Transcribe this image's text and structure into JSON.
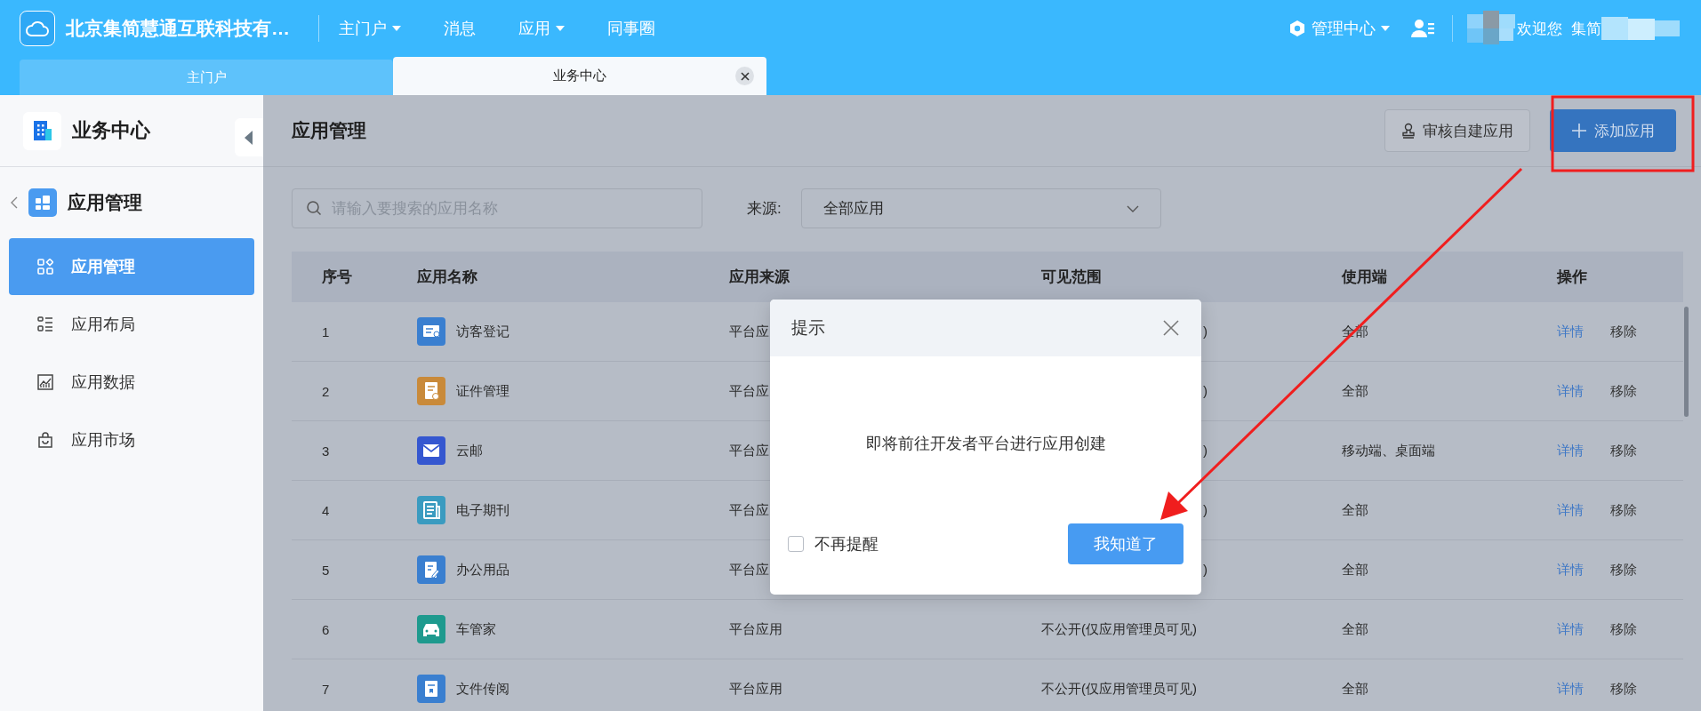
{
  "top_bar": {
    "company_name": "北京集简慧通互联科技有…",
    "nav": [
      {
        "label": "主门户",
        "dropdown": true
      },
      {
        "label": "消息",
        "dropdown": false
      },
      {
        "label": "应用",
        "dropdown": true
      },
      {
        "label": "同事圈",
        "dropdown": false
      }
    ],
    "admin_menu": {
      "label": "管理中心",
      "dropdown": true
    },
    "welcome": "欢迎您",
    "user_name": "集简"
  },
  "page_tabs": [
    {
      "label": "主门户",
      "selected": false,
      "closable": false
    },
    {
      "label": "业务中心",
      "selected": true,
      "closable": true
    }
  ],
  "sidebar": {
    "title": "业务中心",
    "group": "应用管理",
    "items": [
      {
        "label": "应用管理",
        "selected": true
      },
      {
        "label": "应用布局",
        "selected": false
      },
      {
        "label": "应用数据",
        "selected": false
      },
      {
        "label": "应用市场",
        "selected": false
      }
    ]
  },
  "main": {
    "title": "应用管理",
    "buttons": [
      {
        "label": "审核自建应用",
        "kind": "secondary"
      },
      {
        "label": "添加应用",
        "kind": "primary"
      }
    ],
    "search": {
      "placeholder": "请输入要搜索的应用名称"
    },
    "source_filter": {
      "label": "来源:",
      "value": "全部应用"
    }
  },
  "table": {
    "columns": [
      "序号",
      "应用名称",
      "应用来源",
      "可见范围",
      "使用端",
      "操作"
    ],
    "rows": [
      {
        "index": "1",
        "name": "访客登记",
        "color": "#3a7fd0",
        "source": "平台应",
        "visibility": ")",
        "platform": "全部",
        "actions": [
          "详情",
          "移除"
        ],
        "partly_covered": true
      },
      {
        "index": "2",
        "name": "证件管理",
        "color": "#c98a3a",
        "source": "平台应",
        "visibility": ")",
        "platform": "全部",
        "actions": [
          "详情",
          "移除"
        ],
        "partly_covered": true
      },
      {
        "index": "3",
        "name": "云邮",
        "color": "#3557d0",
        "source": "平台应",
        "visibility": ")",
        "platform": "移动端、桌面端",
        "actions": [
          "详情",
          "移除"
        ],
        "partly_covered": true
      },
      {
        "index": "4",
        "name": "电子期刊",
        "color": "#3a9bc0",
        "source": "平台应",
        "visibility": ")",
        "platform": "全部",
        "actions": [
          "详情",
          "移除"
        ],
        "partly_covered": true
      },
      {
        "index": "5",
        "name": "办公用品",
        "color": "#3a7fd0",
        "source": "平台应",
        "visibility": ")",
        "platform": "全部",
        "actions": [
          "详情",
          "移除"
        ],
        "partly_covered": true
      },
      {
        "index": "6",
        "name": "车管家",
        "color": "#1e9a8e",
        "source": "平台应用",
        "visibility": "不公开(仅应用管理员可见)",
        "platform": "全部",
        "actions": [
          "详情",
          "移除"
        ],
        "partly_covered": false
      },
      {
        "index": "7",
        "name": "文件传阅",
        "color": "#3a7fd0",
        "source": "平台应用",
        "visibility": "不公开(仅应用管理员可见)",
        "platform": "全部",
        "actions": [
          "详情",
          "移除"
        ],
        "partly_covered": false
      }
    ]
  },
  "dialog": {
    "title": "提示",
    "message": "即将前往开发者平台进行应用创建",
    "dont_remind": {
      "label": "不再提醒",
      "checked": false
    },
    "confirm": "我知道了"
  }
}
